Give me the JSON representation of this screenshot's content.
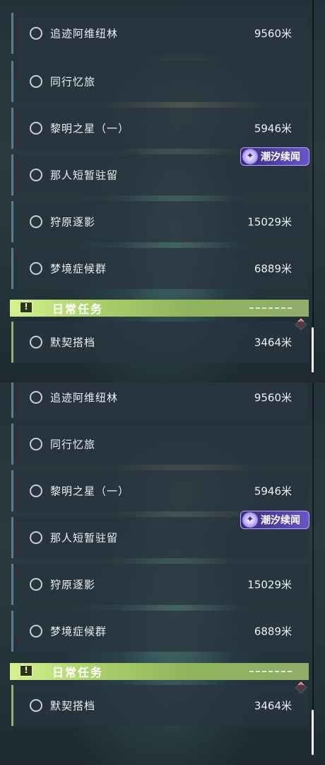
{
  "quests": [
    {
      "name": "追迹阿维纽林",
      "distance": "9560米"
    },
    {
      "name": "同行忆旅",
      "distance": ""
    },
    {
      "name": "黎明之星（一）",
      "distance": "5946米"
    },
    {
      "name": "那人短暂驻留",
      "distance": ""
    },
    {
      "name": "狩原逐影",
      "distance": "15029米"
    },
    {
      "name": "梦境症候群",
      "distance": "6889米"
    }
  ],
  "badge": {
    "label": "潮汐续闻",
    "icon": "tide-story-icon"
  },
  "daily": {
    "header": "日常任务",
    "header_icon": "exclamation-box-icon",
    "quest": {
      "name": "默契搭档",
      "distance": "3464米"
    }
  },
  "colors": {
    "quest_border": "#5d7d8f",
    "daily_accent": "#a9cf6c",
    "badge_accent": "#6a55c8",
    "marker": "#e0505c"
  }
}
